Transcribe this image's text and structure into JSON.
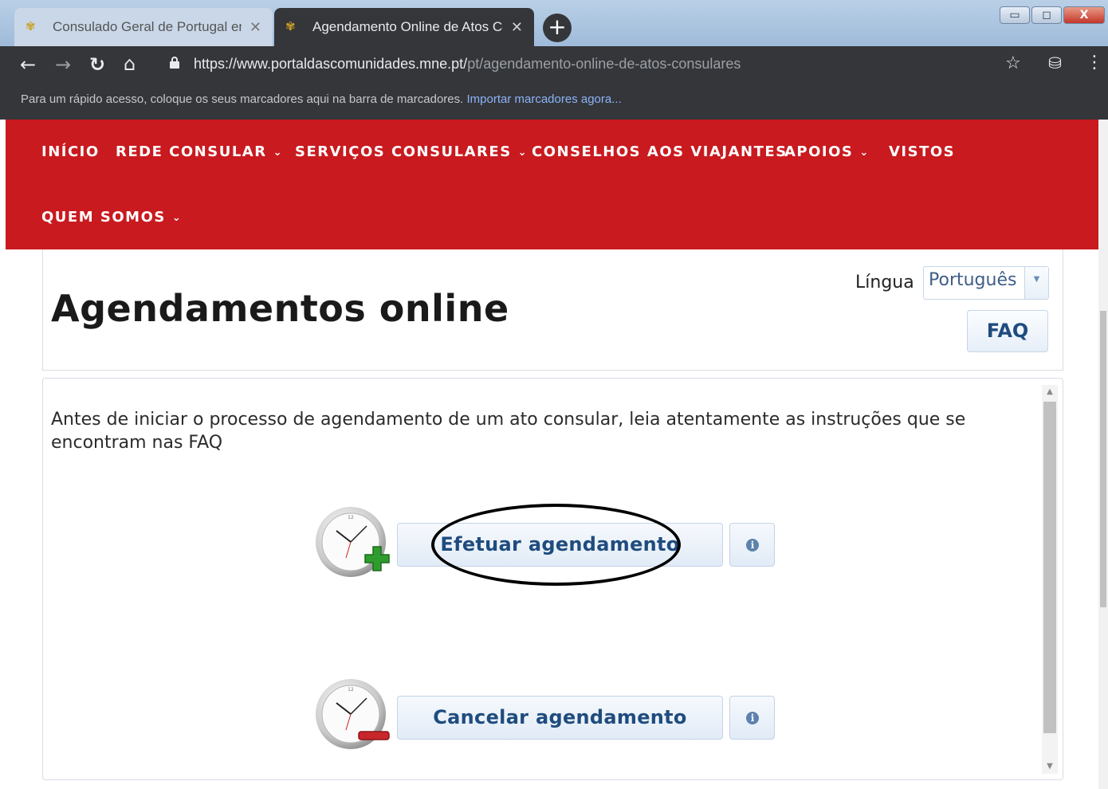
{
  "browser": {
    "tabs": [
      {
        "title": "Consulado Geral de Portugal em",
        "active": false
      },
      {
        "title": "Agendamento Online de Atos Co",
        "active": true
      }
    ],
    "new_tab_label": "+",
    "window_controls": {
      "minimize": "▭",
      "maximize": "◻",
      "close": "X"
    },
    "url_main": "https://www.portaldascomunidades.mne.pt/",
    "url_path": "pt/agendamento-online-de-atos-consulares",
    "bookmarks_text": "Para um rápido acesso, coloque os seus marcadores aqui na barra de marcadores.",
    "bookmarks_link": "Importar marcadores agora..."
  },
  "nav": {
    "items": [
      {
        "label": "INÍCIO",
        "dropdown": false
      },
      {
        "label": "REDE CONSULAR",
        "dropdown": true
      },
      {
        "label": "SERVIÇOS CONSULARES",
        "dropdown": true
      },
      {
        "label": "CONSELHOS AOS VIAJANTES",
        "dropdown": false
      },
      {
        "label": "APOIOS",
        "dropdown": true
      },
      {
        "label": "VISTOS",
        "dropdown": false
      },
      {
        "label": "QUEM SOMOS",
        "dropdown": true
      }
    ],
    "chevron": "⌄"
  },
  "header": {
    "title": "Agendamentos online",
    "language_label": "Língua",
    "language_value": "Português",
    "faq_label": "FAQ"
  },
  "main": {
    "intro": "Antes de iniciar o processo de agendamento de um ato consular, leia atentamente as instruções que se encontram nas FAQ",
    "actions": [
      {
        "label": "Efetuar agendamento",
        "badge": "add",
        "highlighted": true
      },
      {
        "label": "Cancelar agendamento",
        "badge": "remove",
        "highlighted": false
      }
    ],
    "info_glyph": "i"
  },
  "colors": {
    "nav_bg": "#c91a1f",
    "chrome_dark": "#35363a",
    "button_text": "#1f4c7f",
    "add_badge": "#2e9d2e",
    "remove_badge": "#c9262c"
  }
}
